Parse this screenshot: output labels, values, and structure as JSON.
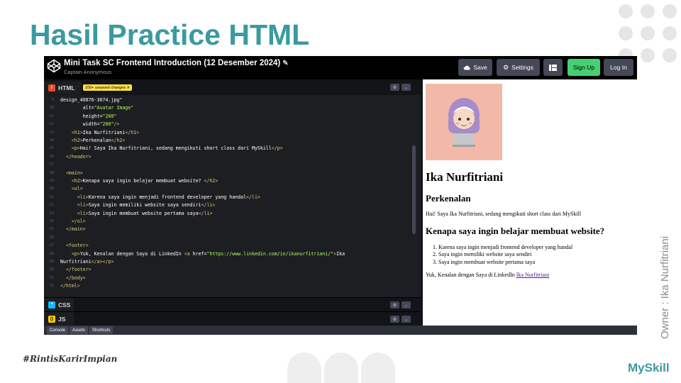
{
  "slide": {
    "title": "Hasil Practice HTML",
    "owner": "Owner : Ika Nurfitriani",
    "hashtag": "#RintisKarirImpian",
    "brand": "MySkill"
  },
  "codepen": {
    "pen_title": "Mini Task SC Frontend Introduction (12 Desember 2024)",
    "author": "Captain Anonymous",
    "buttons": {
      "save": "Save",
      "settings": "Settings",
      "signup": "Sign Up",
      "login": "Log In"
    },
    "panes": {
      "html": "HTML",
      "css": "CSS",
      "js": "JS"
    },
    "unsaved_badge": "100+ unsaved changes ✕",
    "bottom_tabs": [
      "Console",
      "Assets",
      "Shortcuts"
    ],
    "code_lines": [
      "design_40876-3674.jpg\"",
      "        alt=\"Avatar Image\"",
      "        height=\"200\"",
      "        width=\"200\"/>",
      "    <h1>Ika Nurfitriani</h1>",
      "    <h2>Perkenalan</h2>",
      "    <p>Hai! Saya Ika Nurfitriani, sedang mengikuti short class dari MySkill</p>",
      "  </header>",
      "",
      "  <main>",
      "    <h2>Kenapa saya ingin belajar membuat website? </h2>",
      "    <ol>",
      "      <li>Karena saya ingin menjadi frontend developer yang handal</li>",
      "      <li>Saya ingin memiliki website saya sendiri</li>",
      "      <li>Saya ingin membuat website pertama saya</li>",
      "    </ol>",
      "  </main>",
      "",
      "  <footer>",
      "    <p>Yuk, Kenalan dengan Saya di LinkedIn <a href=\"https://www.linkedin.com/in/ikanurfitriani/\">Ika",
      "Nurfitriani</a></p>",
      "  </footer>",
      "  </body>",
      "</html>"
    ]
  },
  "preview": {
    "h1": "Ika Nurfitriani",
    "h2_intro": "Perkenalan",
    "intro_text": "Hai! Saya Ika Nurfitriani, sedang mengikuti short class dari MySkill",
    "h2_why": "Kenapa saya ingin belajar membuat website?",
    "reasons": [
      "Karena saya ingin menjadi frontend developer yang handal",
      "Saya ingin memiliki website saya sendiri",
      "Saya ingin membuat website pertama saya"
    ],
    "footer_text": "Yuk, Kenalan dengan Saya di LinkedIn ",
    "footer_link": "Ika Nurfitriani"
  },
  "colors": {
    "accent": "#3a9aa0",
    "signup_green": "#47cf73",
    "html_icon": "#e44d26",
    "css_icon": "#0ebeff",
    "js_icon": "#fcd000",
    "avatar_bg": "#f2b9a8"
  }
}
